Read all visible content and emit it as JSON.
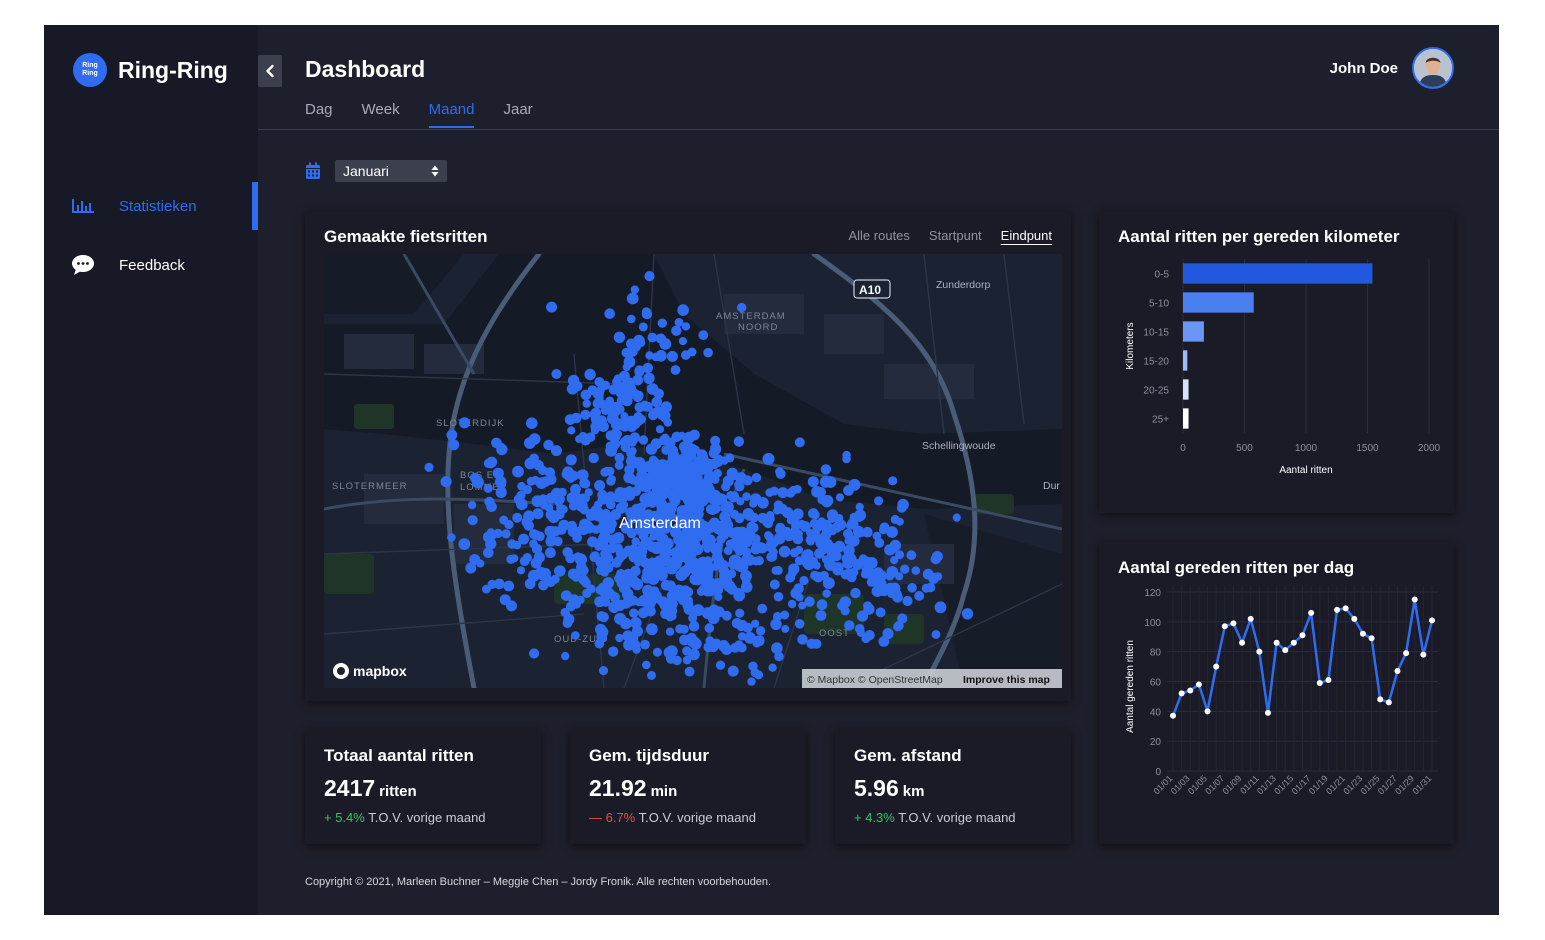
{
  "brand": {
    "name": "Ring-Ring",
    "logo_text_1": "Ring",
    "logo_text_2": "Ring"
  },
  "sidebar": {
    "items": [
      {
        "label": "Statistieken",
        "icon": "bar-chart-icon",
        "active": true
      },
      {
        "label": "Feedback",
        "icon": "chat-icon",
        "active": false
      }
    ]
  },
  "header": {
    "title": "Dashboard",
    "tabs": [
      "Dag",
      "Week",
      "Maand",
      "Jaar"
    ],
    "active_tab": "Maand",
    "user_name": "John Doe"
  },
  "month_select": {
    "value": "Januari",
    "icon": "calendar-icon"
  },
  "map_card": {
    "title": "Gemaakte fietsritten",
    "tabs": [
      "Alle routes",
      "Startpunt",
      "Eindpunt"
    ],
    "active_tab": "Eindpunt",
    "labels": {
      "a10": "A10",
      "zunderdorp": "Zunderdorp",
      "noord_1": "AMSTERDAM",
      "noord_2": "NOORD",
      "spaarndammer": "SLOTERDIJK",
      "bos_1": "BOS EN",
      "bos_2": "LOMMER",
      "slotermeer": "SLOTERMEER",
      "city": "Amsterdam",
      "schellingwoude": "Schellingwoude",
      "dur": "Dur",
      "oud_zuid": "OUD-ZUID",
      "oost": "OOST",
      "mapbox": "mapbox",
      "attribution": "© Mapbox © OpenStreetMap",
      "improve": "Improve this map"
    },
    "marker_color": "#2f6cf0"
  },
  "bar_card": {
    "title": "Aantal ritten per gereden kilometer"
  },
  "line_card": {
    "title": "Aantal gereden ritten per dag"
  },
  "chart_data": [
    {
      "type": "bar",
      "orientation": "horizontal",
      "title": "Aantal ritten per gereden kilometer",
      "categories": [
        "0-5",
        "5-10",
        "10-15",
        "15-20",
        "20-25",
        "25+"
      ],
      "values": [
        1540,
        575,
        170,
        35,
        45,
        45
      ],
      "xlabel": "Aantal ritten",
      "ylabel": "Kilometers",
      "xlim": [
        0,
        2000
      ],
      "xticks": [
        0,
        500,
        1000,
        1500,
        2000
      ],
      "colors": [
        "#2257e0",
        "#4a7ff0",
        "#6a96f5",
        "#9dbbf8",
        "#d6e2fc",
        "#ffffff"
      ],
      "grid": true
    },
    {
      "type": "line",
      "title": "Aantal gereden ritten per dag",
      "x": [
        "01/01",
        "01/02",
        "01/03",
        "01/04",
        "01/05",
        "01/06",
        "01/07",
        "01/08",
        "01/09",
        "01/10",
        "01/11",
        "01/12",
        "01/13",
        "01/14",
        "01/15",
        "01/16",
        "01/17",
        "01/18",
        "01/19",
        "01/20",
        "01/21",
        "01/22",
        "01/23",
        "01/24",
        "01/25",
        "01/26",
        "01/27",
        "01/28",
        "01/29",
        "01/30",
        "01/31"
      ],
      "xticks": [
        "01/01",
        "01/03",
        "01/05",
        "01/07",
        "01/09",
        "01/11",
        "01/13",
        "01/15",
        "01/17",
        "01/19",
        "01/21",
        "01/23",
        "01/25",
        "01/27",
        "01/29",
        "01/31"
      ],
      "values": [
        37,
        52,
        54,
        58,
        40,
        70,
        97,
        99,
        86,
        102,
        80,
        39,
        86,
        81,
        86,
        91,
        106,
        59,
        61,
        108,
        109,
        102,
        92,
        89,
        48,
        46,
        67,
        79,
        115,
        78,
        101
      ],
      "ylabel": "Aantal gereden ritten",
      "ylim": [
        0,
        120
      ],
      "yticks": [
        0,
        20,
        40,
        60,
        80,
        100,
        120
      ],
      "color": "#2f6cf0",
      "grid": true
    }
  ],
  "stats": [
    {
      "title": "Totaal aantal ritten",
      "value": "2417",
      "unit": "ritten",
      "change": "+ 5.4%",
      "direction": "up",
      "suffix": "T.O.V. vorige maand"
    },
    {
      "title": "Gem. tijdsduur",
      "value": "21.92",
      "unit": "min",
      "change": "— 6.7%",
      "direction": "down",
      "suffix": "T.O.V. vorige maand"
    },
    {
      "title": "Gem. afstand",
      "value": "5.96",
      "unit": "km",
      "change": "+ 4.3%",
      "direction": "up",
      "suffix": "T.O.V. vorige maand"
    }
  ],
  "footer": {
    "text": "Copyright © 2021, Marleen Buchner – Meggie Chen – Jordy Fronik. Alle rechten voorbehouden."
  }
}
